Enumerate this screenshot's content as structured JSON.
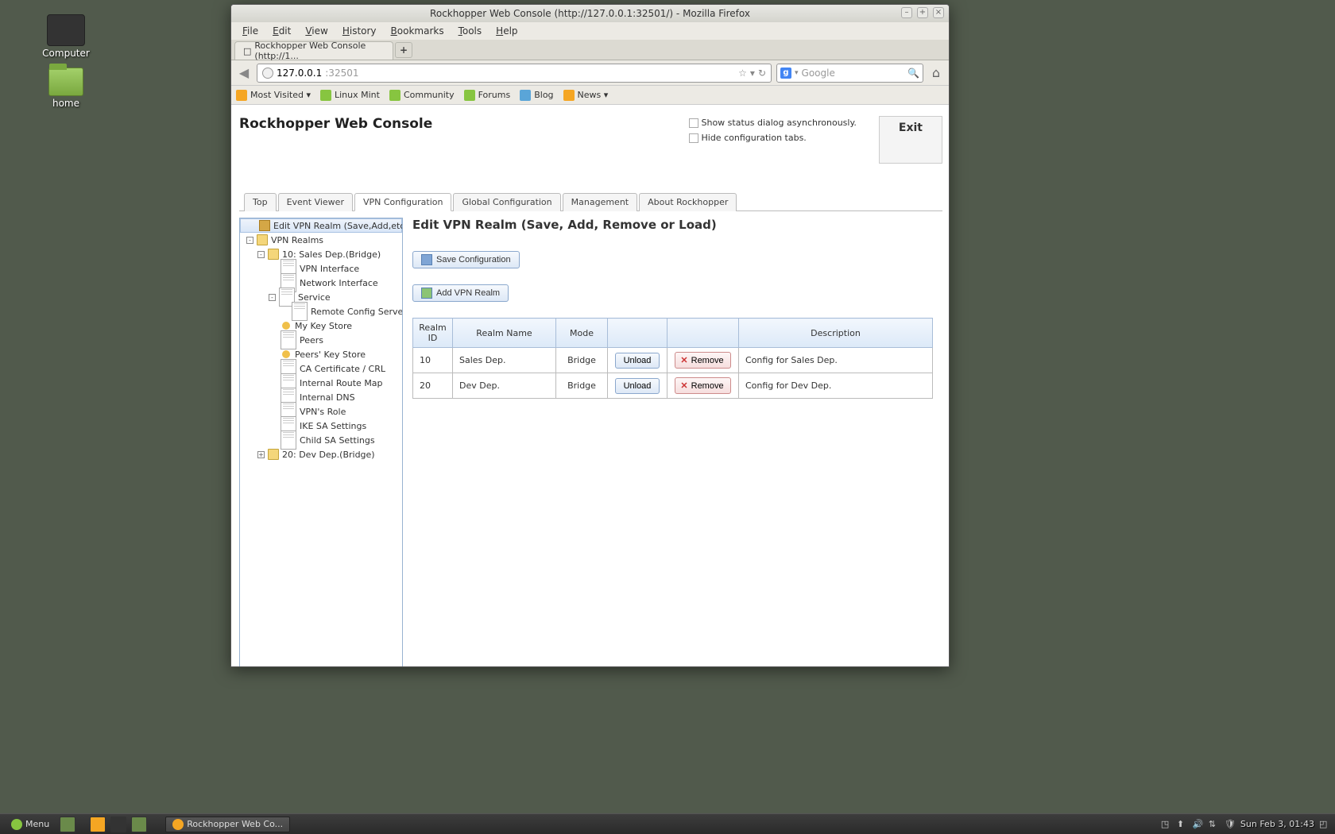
{
  "desktop": {
    "computer": "Computer",
    "home": "home"
  },
  "window": {
    "title": "Rockhopper Web Console (http://127.0.0.1:32501/) - Mozilla Firefox",
    "menu": [
      "File",
      "Edit",
      "View",
      "History",
      "Bookmarks",
      "Tools",
      "Help"
    ],
    "tab_label": "Rockhopper Web Console (http://1...",
    "url_primary": "127.0.0.1",
    "url_secondary": ":32501",
    "search_placeholder": "Google",
    "bookmarks": [
      "Most Visited ▾",
      "Linux Mint",
      "Community",
      "Forums",
      "Blog",
      "News ▾"
    ]
  },
  "page": {
    "title": "Rockhopper Web Console",
    "checkbox1": "Show status dialog asynchronously.",
    "checkbox2": "Hide configuration tabs.",
    "exit": "Exit",
    "tabs": [
      "Top",
      "Event Viewer",
      "VPN Configuration",
      "Global Configuration",
      "Management",
      "About Rockhopper"
    ],
    "active_tab": 2
  },
  "tree": {
    "items": [
      {
        "label": "Edit VPN Realm (Save,Add,etc.)",
        "icon": "gear",
        "indent": 0,
        "exp": "",
        "selected": true
      },
      {
        "label": "VPN Realms",
        "icon": "folder-open",
        "indent": 0,
        "exp": "-"
      },
      {
        "label": "10: Sales Dep.(Bridge)",
        "icon": "folder-open",
        "indent": 1,
        "exp": "-"
      },
      {
        "label": "VPN Interface",
        "icon": "page",
        "indent": 2,
        "exp": ""
      },
      {
        "label": "Network Interface",
        "icon": "page",
        "indent": 2,
        "exp": ""
      },
      {
        "label": "Service",
        "icon": "page",
        "indent": 2,
        "exp": "-"
      },
      {
        "label": "Remote Config Server",
        "icon": "page",
        "indent": 3,
        "exp": ""
      },
      {
        "label": "My Key Store",
        "icon": "key",
        "indent": 2,
        "exp": ""
      },
      {
        "label": "Peers",
        "icon": "page",
        "indent": 2,
        "exp": ""
      },
      {
        "label": "Peers' Key Store",
        "icon": "key",
        "indent": 2,
        "exp": ""
      },
      {
        "label": "CA Certificate / CRL",
        "icon": "page",
        "indent": 2,
        "exp": ""
      },
      {
        "label": "Internal Route Map",
        "icon": "page",
        "indent": 2,
        "exp": ""
      },
      {
        "label": "Internal DNS",
        "icon": "page",
        "indent": 2,
        "exp": ""
      },
      {
        "label": "VPN's Role",
        "icon": "page",
        "indent": 2,
        "exp": ""
      },
      {
        "label": "IKE SA Settings",
        "icon": "page",
        "indent": 2,
        "exp": ""
      },
      {
        "label": "Child SA Settings",
        "icon": "page",
        "indent": 2,
        "exp": ""
      },
      {
        "label": "20: Dev Dep.(Bridge)",
        "icon": "folder",
        "indent": 1,
        "exp": "+"
      }
    ]
  },
  "main": {
    "heading": "Edit VPN Realm (Save, Add, Remove or Load)",
    "save_btn": "Save Configuration",
    "add_btn": "Add VPN Realm",
    "columns": [
      "Realm ID",
      "Realm Name",
      "Mode",
      "",
      "",
      "Description"
    ],
    "rows": [
      {
        "id": "10",
        "name": "Sales Dep.",
        "mode": "Bridge",
        "unload": "Unload",
        "remove": "Remove",
        "desc": "Config for Sales Dep."
      },
      {
        "id": "20",
        "name": "Dev Dep.",
        "mode": "Bridge",
        "unload": "Unload",
        "remove": "Remove",
        "desc": "Config for Dev Dep."
      }
    ]
  },
  "taskbar": {
    "menu": "Menu",
    "task": "Rockhopper Web Co...",
    "clock": "Sun Feb  3, 01:43"
  }
}
